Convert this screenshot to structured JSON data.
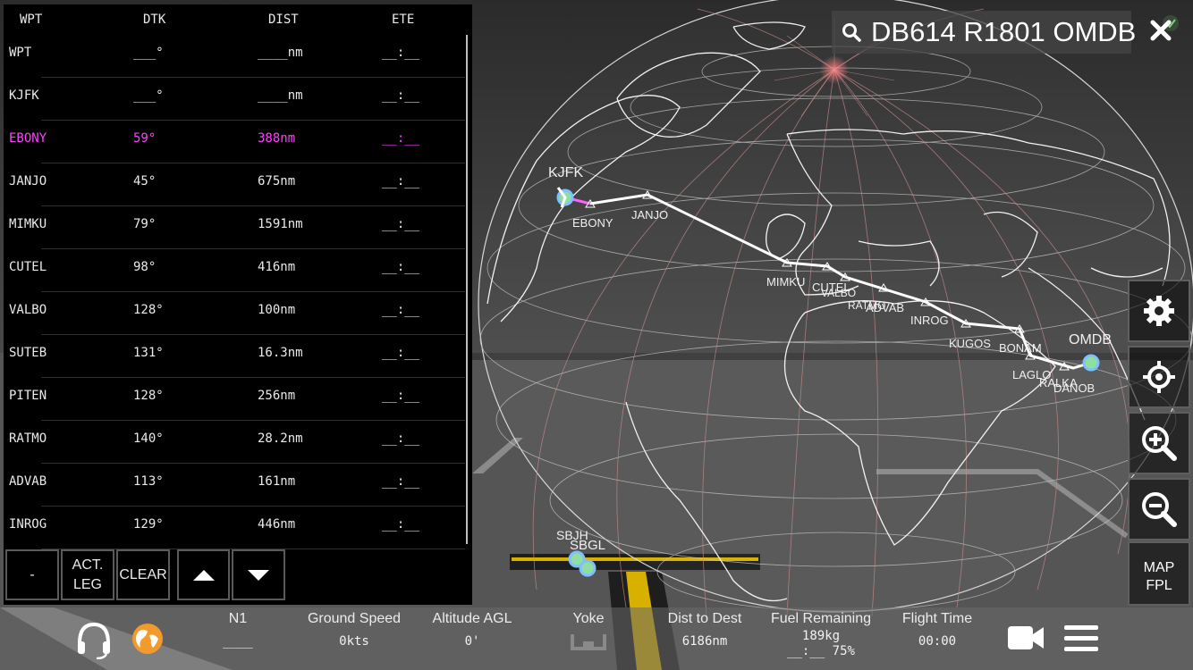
{
  "search": {
    "query": "DB614 R1801 OMDB"
  },
  "fpl": {
    "headers": {
      "wpt": "WPT",
      "dtk": "DTK",
      "dist": "DIST",
      "ete": "ETE"
    },
    "rows": [
      {
        "wpt": "WPT",
        "dtk": "___°",
        "dist": "____nm",
        "ete": "__:__",
        "active": false
      },
      {
        "wpt": "KJFK",
        "dtk": "___°",
        "dist": "____nm",
        "ete": "__:__",
        "active": false
      },
      {
        "wpt": "EBONY",
        "dtk": "59°",
        "dist": "388nm",
        "ete": "__:__",
        "active": true
      },
      {
        "wpt": "JANJO",
        "dtk": "45°",
        "dist": "675nm",
        "ete": "__:__",
        "active": false
      },
      {
        "wpt": "MIMKU",
        "dtk": "79°",
        "dist": "1591nm",
        "ete": "__:__",
        "active": false
      },
      {
        "wpt": "CUTEL",
        "dtk": "98°",
        "dist": "416nm",
        "ete": "__:__",
        "active": false
      },
      {
        "wpt": "VALBO",
        "dtk": "128°",
        "dist": "100nm",
        "ete": "__:__",
        "active": false
      },
      {
        "wpt": "SUTEB",
        "dtk": "131°",
        "dist": "16.3nm",
        "ete": "__:__",
        "active": false
      },
      {
        "wpt": "PITEN",
        "dtk": "128°",
        "dist": "256nm",
        "ete": "__:__",
        "active": false
      },
      {
        "wpt": "RATMO",
        "dtk": "140°",
        "dist": "28.2nm",
        "ete": "__:__",
        "active": false
      },
      {
        "wpt": "ADVAB",
        "dtk": "113°",
        "dist": "161nm",
        "ete": "__:__",
        "active": false
      },
      {
        "wpt": "INROG",
        "dtk": "129°",
        "dist": "446nm",
        "ete": "__:__",
        "active": false
      }
    ],
    "buttons": {
      "minus": "-",
      "act_leg_1": "ACT.",
      "act_leg_2": "LEG",
      "clear": "CLEAR"
    }
  },
  "map": {
    "labels": {
      "kjfk": "KJFK",
      "ebony": "EBONY",
      "janjo": "JANJO",
      "mimku": "MIMKU",
      "cutel": "CUTEL",
      "valbo": "VALBO",
      "ratmo": "RATMO",
      "advab": "ADVAB",
      "inrog": "INROG",
      "kugos": "KUGOS",
      "bonam": "BONAM",
      "laglo": "LAGLO",
      "ralka": "RALKA",
      "danob": "DANOB",
      "omdb": "OMDB",
      "sbgl": "SBGL",
      "sbxx": "SBJH"
    }
  },
  "toolbar": {
    "map_label": "MAP",
    "fpl_label": "FPL"
  },
  "bottom": {
    "n1": {
      "label": "N1",
      "value": "____"
    },
    "gs": {
      "label": "Ground Speed",
      "value": "0kts"
    },
    "agl": {
      "label": "Altitude AGL",
      "value": "0'"
    },
    "yoke": {
      "label": "Yoke"
    },
    "dist": {
      "label": "Dist to Dest",
      "value": "6186nm"
    },
    "fuel": {
      "label": "Fuel Remaining",
      "value": "189kg",
      "value2": "__:__ 75%"
    },
    "time": {
      "label": "Flight Time",
      "value": "00:00"
    }
  },
  "colors": {
    "active_waypoint": "#ff40ff",
    "route": "#ffffff",
    "accent_globe": "#f39a2c"
  }
}
